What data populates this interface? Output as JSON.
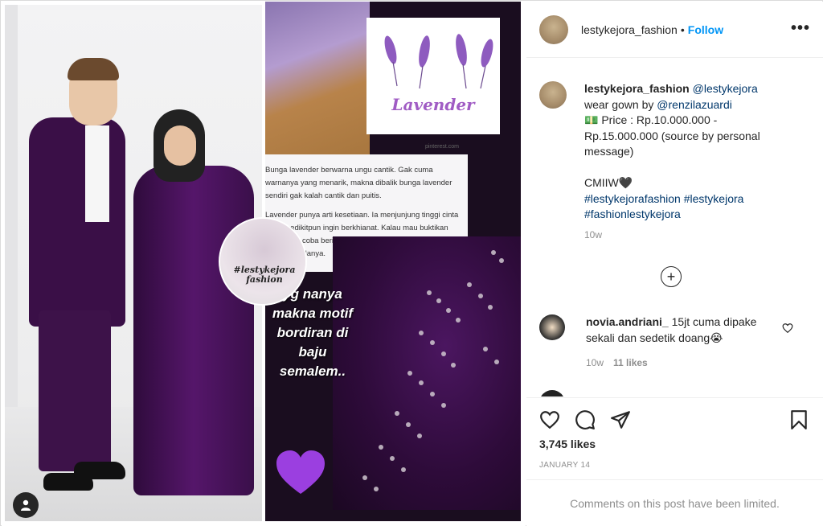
{
  "post": {
    "username": "lestykejora_fashion",
    "follow_label": "Follow",
    "separator": "•",
    "more_label": "•••"
  },
  "image": {
    "pinterest_label": "pinterest.com",
    "lavender_title": "Lavender",
    "article_p1": "Bunga lavender berwarna ungu cantik. Gak cuma warnanya yang menarik, makna dibalik bunga lavender sendiri gak kalah cantik dan puitis.",
    "article_p2": "Lavender punya arti kesetiaan. Ia menjunjung tinggi cinta tanpa sedikitpun ingin berkhianat. Kalau mau buktikan kesetiaan, coba berikan bunga sebagai lambang rasa setiamu padanya.",
    "overlay_text": "yg nanya makna motif bordiran di baju semalem..",
    "watermark": "#lestykejora fashion"
  },
  "caption": {
    "username": "lestykejora_fashion",
    "mention": "@lestykejora",
    "line1": "wear gown by",
    "mention2": "@renzilazuardi",
    "price_emoji": "💵",
    "price": "Price : Rp.10.000.000 - Rp.15.000.000 (source by personal message)",
    "cmiiw": "CMIIW🖤",
    "hashtags": "#lestykejorafashion #lestykejora #fashionlestykejora",
    "time": "10w"
  },
  "comment": {
    "username": "novia.andriani_",
    "text": "15jt cuma dipake sekali dan sedetik doang😭",
    "time": "10w",
    "likes": "11 likes"
  },
  "peek": {
    "text": "… … …"
  },
  "stats": {
    "likes": "3,745 likes",
    "date": "JANUARY 14"
  },
  "footer": {
    "limited": "Comments on this post have been limited."
  },
  "icons": [
    "heart-icon",
    "comment-icon",
    "share-icon",
    "bookmark-icon",
    "plus-circle-icon",
    "more-icon",
    "user-icon"
  ]
}
